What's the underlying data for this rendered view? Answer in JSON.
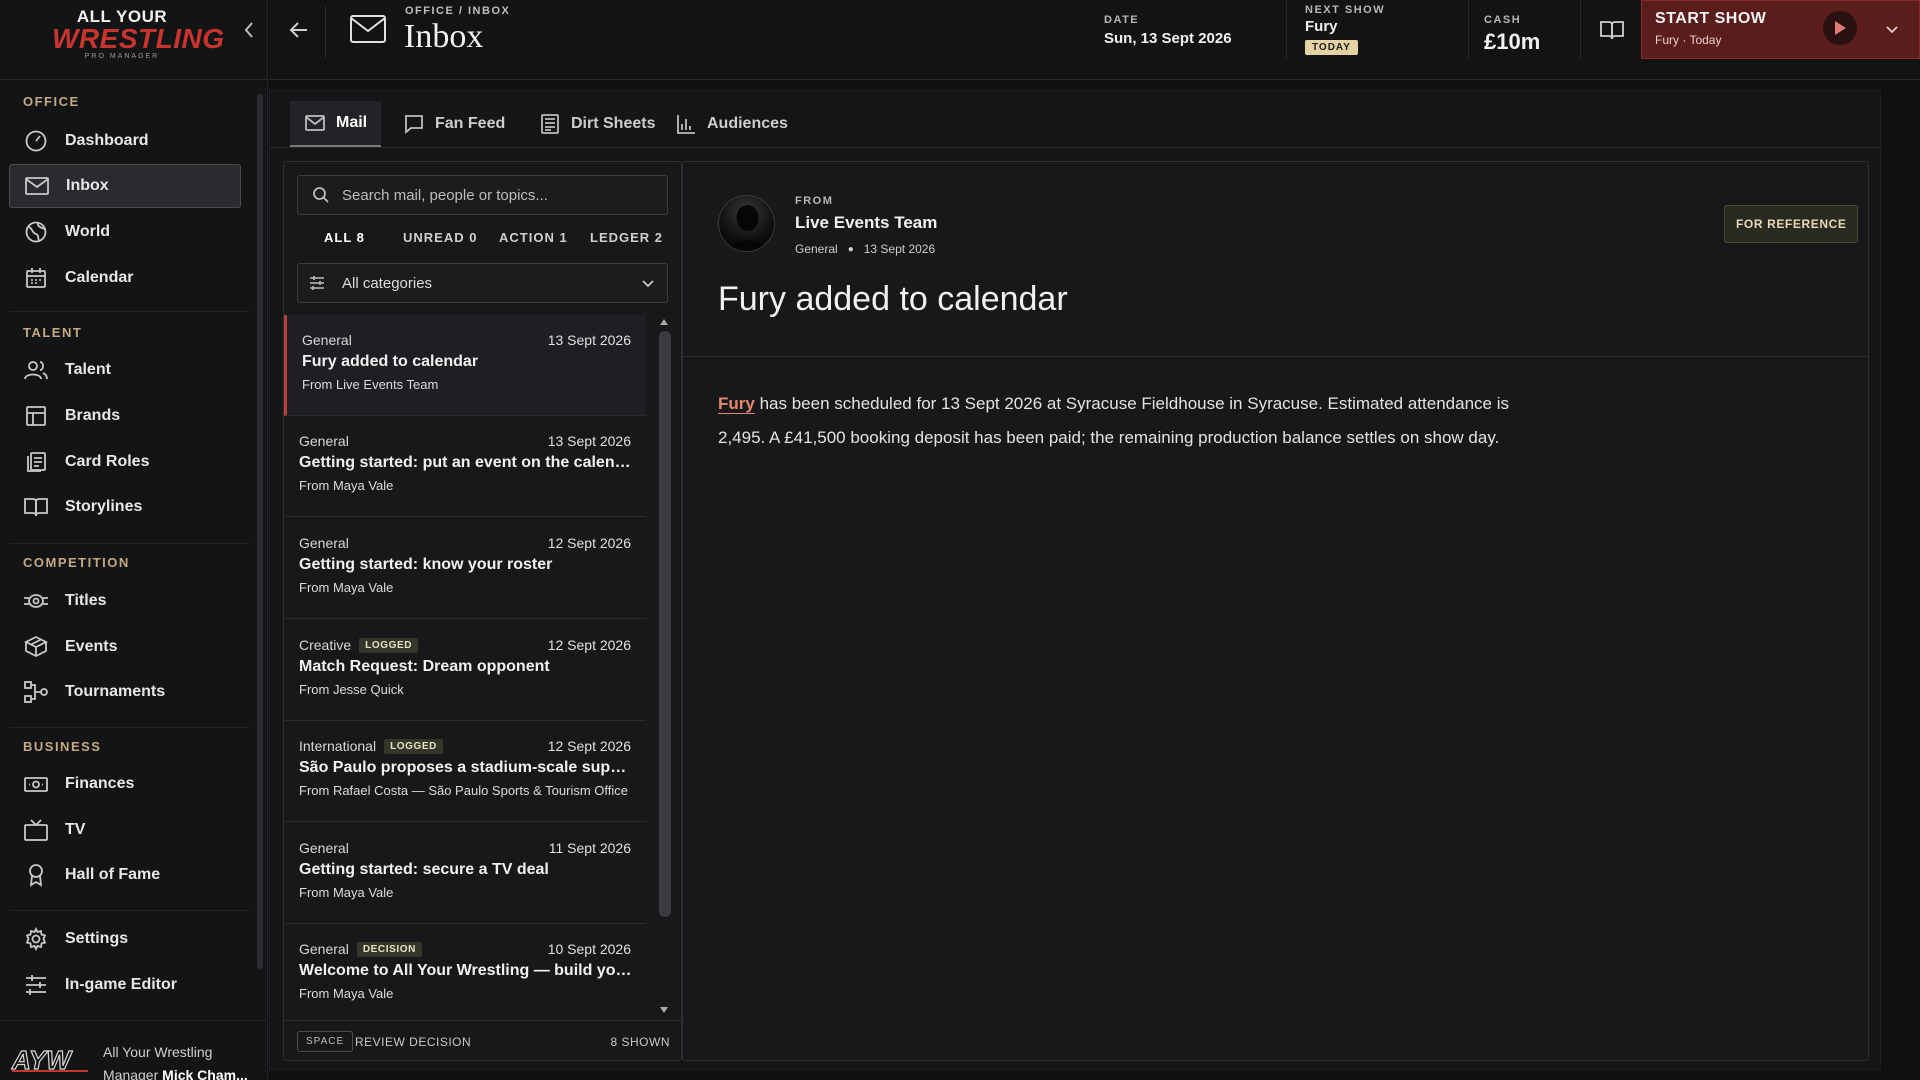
{
  "brand": {
    "logo_line1": "ALL YOUR",
    "logo_line2": "WRESTLING",
    "logo_line3": "PRO MANAGER",
    "accent": "#c9342f"
  },
  "sidebar": {
    "sections": [
      {
        "label": "OFFICE"
      },
      {
        "label": "TALENT"
      },
      {
        "label": "COMPETITION"
      },
      {
        "label": "BUSINESS"
      }
    ],
    "items": [
      {
        "label": "Dashboard",
        "icon": "gauge-icon"
      },
      {
        "label": "Inbox",
        "icon": "mail-icon",
        "active": true
      },
      {
        "label": "World",
        "icon": "globe-icon"
      },
      {
        "label": "Calendar",
        "icon": "calendar-icon"
      },
      {
        "label": "Talent",
        "icon": "people-icon"
      },
      {
        "label": "Brands",
        "icon": "layout-icon"
      },
      {
        "label": "Card Roles",
        "icon": "cards-icon"
      },
      {
        "label": "Storylines",
        "icon": "book-icon"
      },
      {
        "label": "Titles",
        "icon": "belt-icon"
      },
      {
        "label": "Events",
        "icon": "arena-icon"
      },
      {
        "label": "Tournaments",
        "icon": "bracket-icon"
      },
      {
        "label": "Finances",
        "icon": "cash-icon"
      },
      {
        "label": "TV",
        "icon": "tv-icon"
      },
      {
        "label": "Hall of Fame",
        "icon": "award-icon"
      },
      {
        "label": "Settings",
        "icon": "gear-icon"
      },
      {
        "label": "In-game Editor",
        "icon": "sliders-icon"
      }
    ],
    "footer": {
      "company": "All Your Wrestling",
      "manager_prefix": "Manager",
      "manager_name": "Mick Cham..."
    }
  },
  "topbar": {
    "breadcrumb": "OFFICE / INBOX",
    "title": "Inbox",
    "date_label": "DATE",
    "date_value": "Sun, 13 Sept 2026",
    "next_show_label": "NEXT SHOW",
    "next_show_value": "Fury",
    "next_show_badge": "TODAY",
    "cash_label": "CASH",
    "cash_value": "£10m",
    "start_show_label": "START SHOW",
    "start_show_sub": "Fury · Today"
  },
  "tabs": [
    {
      "label": "Mail",
      "icon": "mail-icon",
      "active": true
    },
    {
      "label": "Fan Feed",
      "icon": "chat-icon"
    },
    {
      "label": "Dirt Sheets",
      "icon": "newspaper-icon"
    },
    {
      "label": "Audiences",
      "icon": "bar-chart-icon"
    }
  ],
  "list": {
    "search_placeholder": "Search mail, people or topics...",
    "filters": [
      {
        "label": "ALL",
        "count": "8",
        "active": true
      },
      {
        "label": "UNREAD",
        "count": "0"
      },
      {
        "label": "ACTION",
        "count": "1"
      },
      {
        "label": "LEDGER",
        "count": "2"
      }
    ],
    "category_select": "All categories",
    "messages": [
      {
        "category": "General",
        "badge": "",
        "date": "13 Sept 2026",
        "subject": "Fury added to calendar",
        "from": "From Live Events Team",
        "selected": true
      },
      {
        "category": "General",
        "badge": "",
        "date": "13 Sept 2026",
        "subject": "Getting started: put an event on the calendar",
        "from": "From Maya Vale"
      },
      {
        "category": "General",
        "badge": "",
        "date": "12 Sept 2026",
        "subject": "Getting started: know your roster",
        "from": "From Maya Vale"
      },
      {
        "category": "Creative",
        "badge": "LOGGED",
        "date": "12 Sept 2026",
        "subject": "Match Request: Dream opponent",
        "from": "From Jesse Quick"
      },
      {
        "category": "International",
        "badge": "LOGGED",
        "date": "12 Sept 2026",
        "subject": "São Paulo proposes a stadium-scale super show",
        "from": "From Rafael Costa — São Paulo Sports & Tourism Office"
      },
      {
        "category": "General",
        "badge": "",
        "date": "11 Sept 2026",
        "subject": "Getting started: secure a TV deal",
        "from": "From Maya Vale"
      },
      {
        "category": "General",
        "badge": "DECISION",
        "date": "10 Sept 2026",
        "subject": "Welcome to All Your Wrestling — build your promotion",
        "from": "From Maya Vale"
      }
    ],
    "footer_key": "SPACE",
    "footer_action": "REVIEW DECISION",
    "footer_count": "8 SHOWN"
  },
  "reader": {
    "from_label": "FROM",
    "sender": "Live Events Team",
    "category": "General",
    "date": "13 Sept 2026",
    "badge": "FOR REFERENCE",
    "title": "Fury added to calendar",
    "body_highlight": "Fury",
    "body_text": " has been scheduled for 13 Sept 2026 at Syracuse Fieldhouse in Syracuse. Estimated attendance is 2,495. A £41,500 booking deposit has been paid; the remaining production balance settles on show day."
  }
}
